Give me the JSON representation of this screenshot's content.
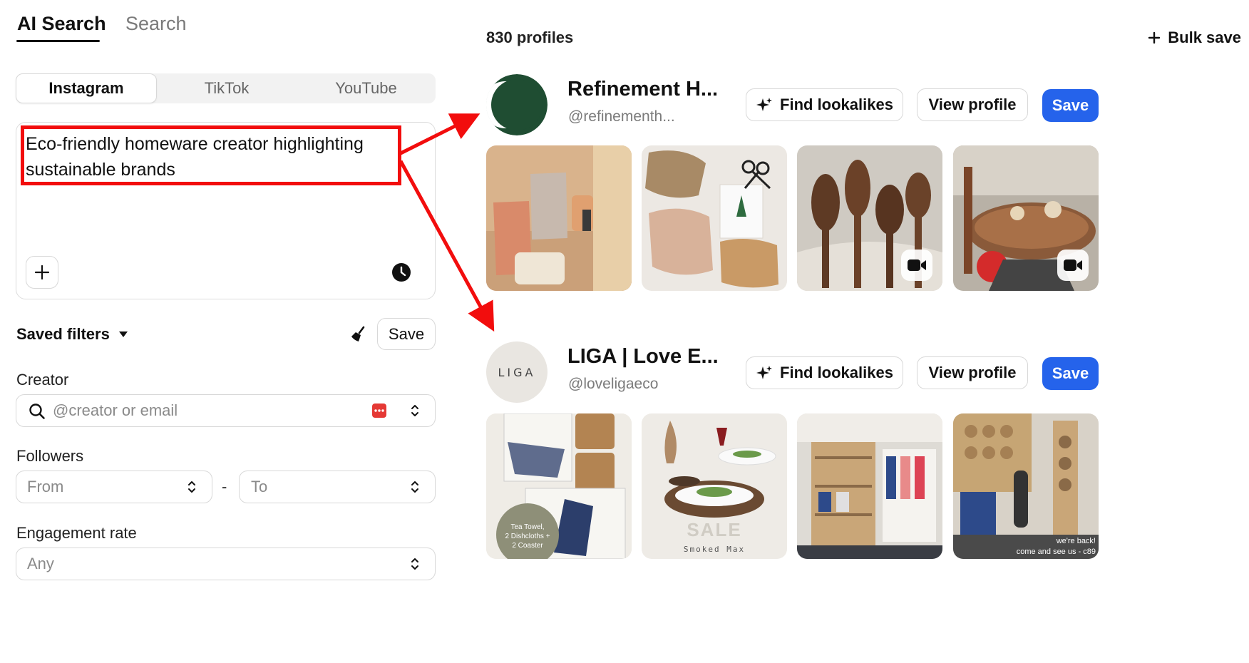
{
  "tabs": {
    "ai_search": "AI Search",
    "search": "Search"
  },
  "platforms": [
    "Instagram",
    "TikTok",
    "YouTube"
  ],
  "prompt": {
    "text": "Eco-friendly homeware creator highlighting sustainable brands"
  },
  "filters": {
    "saved_filters_label": "Saved filters",
    "save_label": "Save",
    "creator": {
      "label": "Creator",
      "placeholder": "@creator or email"
    },
    "followers": {
      "label": "Followers",
      "from_placeholder": "From",
      "separator": "-",
      "to_placeholder": "To"
    },
    "engagement": {
      "label": "Engagement rate",
      "value": "Any"
    }
  },
  "results": {
    "count_text": "830 profiles",
    "bulk_save_label": "Bulk save",
    "profiles": [
      {
        "name": "Refinement H...",
        "handle": "@refinementh...",
        "find_label": "Find lookalikes",
        "view_label": "View profile",
        "save_label": "Save",
        "avatar_color": "#1f4d32"
      },
      {
        "name": "LIGA | Love E...",
        "handle": "@loveligaeco",
        "find_label": "Find lookalikes",
        "view_label": "View profile",
        "save_label": "Save",
        "avatar_text": "LIGA",
        "thumb1_badge": "Tea Towel,\n2 Dishcloths +\n2 Coaster",
        "thumb2_caption": "SALE",
        "thumb2_subcaption": "Smoked Max",
        "thumb4_caption_1": "we're back!",
        "thumb4_caption_2": "come and see us - c89"
      }
    ]
  },
  "colors": {
    "accent": "#2563eb",
    "annotation": "#f20d0d"
  }
}
